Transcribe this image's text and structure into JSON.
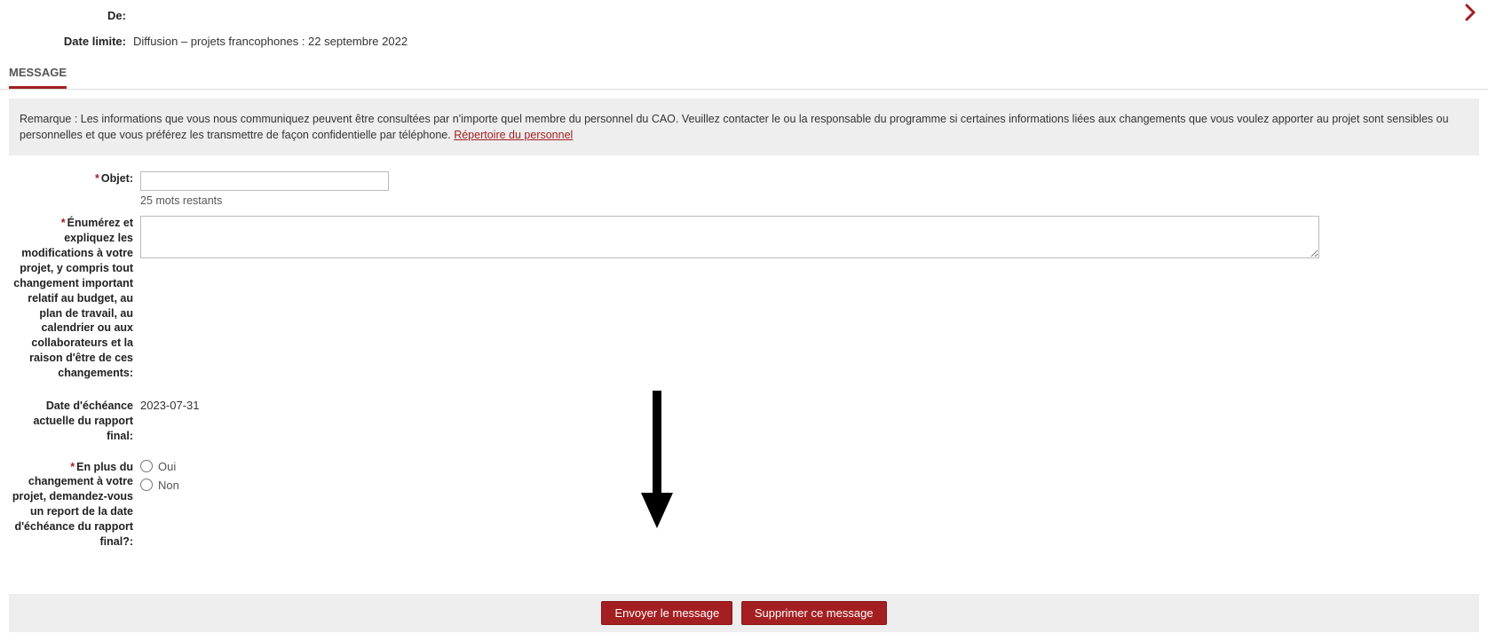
{
  "nav": {
    "next_name": "next-page-icon"
  },
  "header": {
    "from_label": "De:",
    "from_value": "",
    "deadline_label": "Date limite:",
    "deadline_value": "Diffusion – projets francophones : 22 septembre 2022"
  },
  "tab": {
    "label": "MESSAGE"
  },
  "notice": {
    "prefix": "Remarque : Les informations que vous nous communiquez peuvent être consultées par n'importe quel membre du personnel du CAO. Veuillez contacter le ou la responsable du programme si certaines informations liées aux changements que vous voulez apporter au projet sont sensibles ou personnelles et que vous préférez les transmettre de façon confidentielle par téléphone. ",
    "link_text": "Répertoire du personnel"
  },
  "form": {
    "objet_label": "Objet:",
    "objet_value": "",
    "objet_hint": "25 mots restants",
    "explain_label": "Énumérez et expliquez les modifications à votre projet, y compris tout changement important relatif au budget, au plan de travail, au calendrier ou aux collaborateurs et la raison d'être de ces changements:",
    "explain_value": "",
    "due_label": "Date d'échéance actuelle du rapport final:",
    "due_value": "2023-07-31",
    "extend_label": "En plus du changement à votre projet, demandez-vous un report de la date d'échéance du rapport final?:",
    "radio_yes": "Oui",
    "radio_no": "Non"
  },
  "buttons": {
    "send": "Envoyer le message",
    "delete": "Supprimer ce message"
  }
}
